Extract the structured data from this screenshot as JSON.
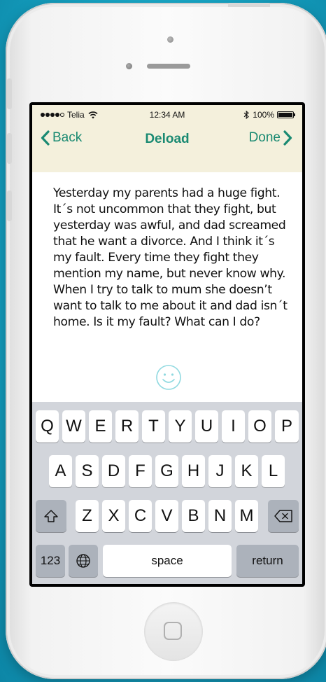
{
  "status_bar": {
    "carrier": "Telia",
    "time": "12:34 AM",
    "battery": "100%"
  },
  "nav": {
    "back_label": "Back",
    "title": "Deload",
    "done_label": "Done"
  },
  "message": {
    "text": "Yesterday my parents had a huge fight. It´s not uncommon that they fight, but yesterday was awful, and dad screamed that he want a divorce. And I think it´s my fault. Every time they fight they mention my name, but never know why. When I try to talk to mum she doesn’t want to talk to me about it and dad isn´t home. Is it my fault? What can I do?"
  },
  "keyboard": {
    "row1": [
      "Q",
      "W",
      "E",
      "R",
      "T",
      "Y",
      "U",
      "I",
      "O",
      "P"
    ],
    "row2": [
      "A",
      "S",
      "D",
      "F",
      "G",
      "H",
      "J",
      "K",
      "L"
    ],
    "row3": [
      "Z",
      "X",
      "C",
      "V",
      "B",
      "N",
      "M"
    ],
    "numbers_label": "123",
    "space_label": "space",
    "return_label": "return"
  },
  "colors": {
    "accent": "#1a8a72",
    "nav_bg": "#f4f0dc",
    "keyboard_bg": "#d2d5db",
    "background": "#16a4c4"
  },
  "icons": [
    "signal-icon",
    "wifi-icon",
    "bluetooth-icon",
    "battery-icon",
    "chevron-left-icon",
    "chevron-right-icon",
    "smiley-icon",
    "shift-icon",
    "globe-icon",
    "backspace-icon"
  ]
}
